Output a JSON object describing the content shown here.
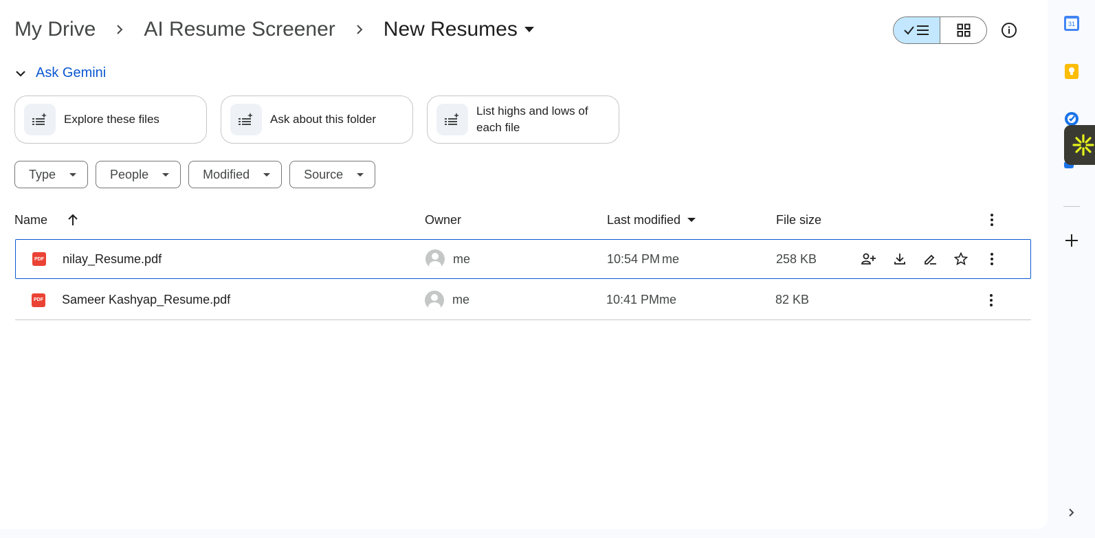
{
  "breadcrumb": {
    "items": [
      "My Drive",
      "AI Resume Screener",
      "New Resumes"
    ]
  },
  "view_toggle": {
    "active": "list"
  },
  "gemini": {
    "toggle_label": "Ask Gemini",
    "chips": [
      {
        "line1": "Explore these files",
        "line2": ""
      },
      {
        "line1": "Ask about this folder",
        "line2": ""
      },
      {
        "line1": "List highs and lows of",
        "line2": "each file"
      }
    ]
  },
  "filters": [
    "Type",
    "People",
    "Modified",
    "Source"
  ],
  "table": {
    "headers": {
      "name": "Name",
      "owner": "Owner",
      "last_modified": "Last modified",
      "file_size": "File size"
    },
    "rows": [
      {
        "name": "nilay_Resume.pdf",
        "owner": "me",
        "modified": "10:54 PM",
        "modified_by": "me",
        "size": "258 KB",
        "selected": true
      },
      {
        "name": "Sameer Kashyap_Resume.pdf",
        "owner": "me",
        "modified": "10:41 PM",
        "modified_by": "me",
        "size": "82 KB",
        "selected": false
      }
    ]
  },
  "file_icon_label": "PDF",
  "side_panel": {
    "calendar_day": "31"
  },
  "colors": {
    "accent": "#0b57d0",
    "toggle_active": "#c2e7ff",
    "pdf_red": "#ea4335"
  }
}
